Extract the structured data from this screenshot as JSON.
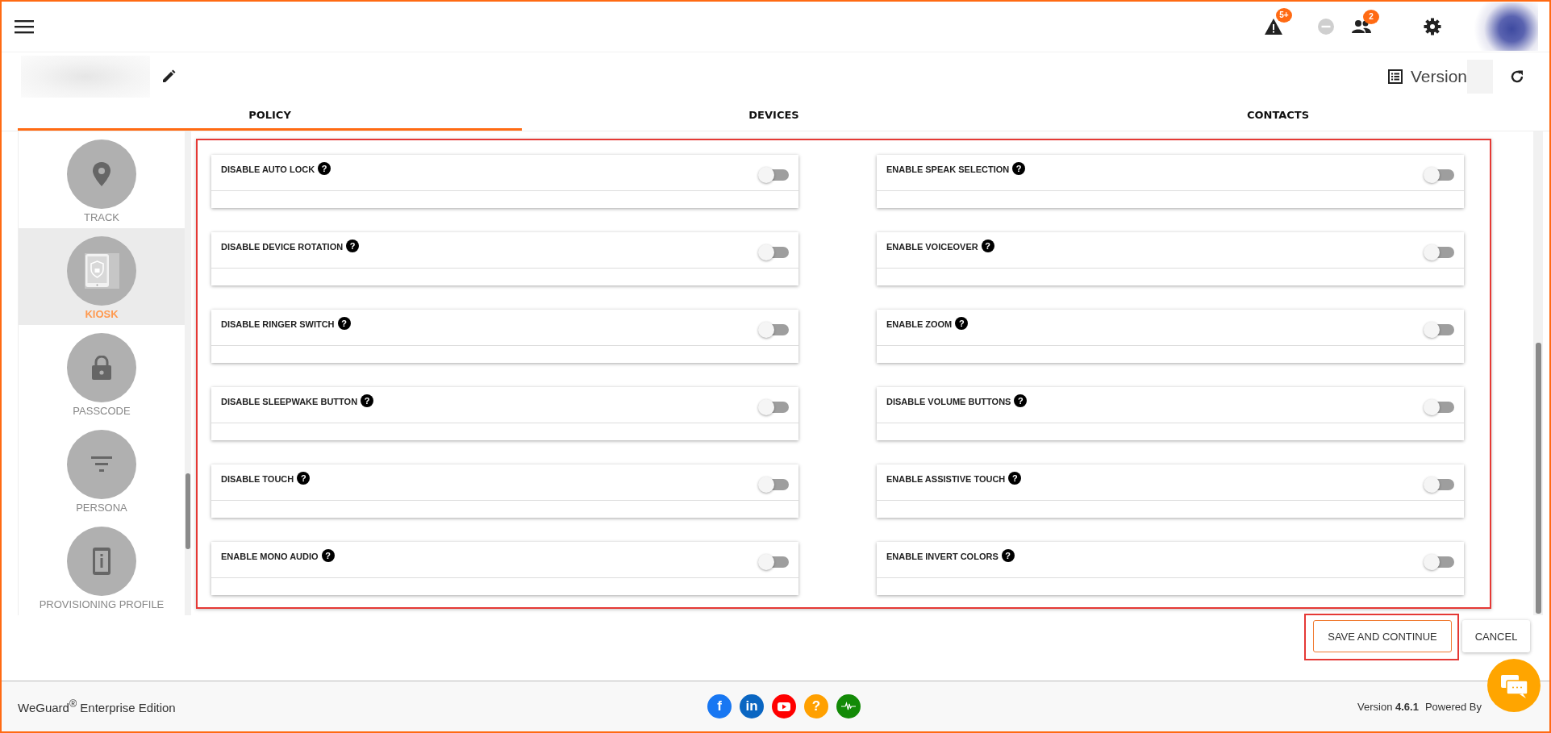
{
  "header": {
    "icons": [
      {
        "kind": "alert",
        "badge": "5+"
      },
      {
        "kind": "status"
      },
      {
        "kind": "people",
        "badge": "2"
      },
      {
        "kind": "settings"
      }
    ]
  },
  "policy": {
    "version_label": "Version"
  },
  "tabs": [
    {
      "label": "POLICY",
      "selected": true
    },
    {
      "label": "DEVICES",
      "selected": false
    },
    {
      "label": "CONTACTS",
      "selected": false
    }
  ],
  "sidebar": {
    "items": [
      {
        "label": "TRACK",
        "kind": "pin",
        "selected": false
      },
      {
        "label": "KIOSK",
        "kind": "kiosk",
        "selected": true
      },
      {
        "label": "PASSCODE",
        "kind": "lock",
        "selected": false
      },
      {
        "label": "PERSONA",
        "kind": "filter",
        "selected": false
      },
      {
        "label": "PROVISIONING PROFILE",
        "kind": "info",
        "selected": false
      }
    ]
  },
  "settings": [
    {
      "label": "DISABLE AUTO LOCK",
      "hint": "?",
      "on": false
    },
    {
      "label": "ENABLE SPEAK SELECTION",
      "hint": "?",
      "on": false
    },
    {
      "label": "DISABLE DEVICE ROTATION",
      "hint": "?",
      "on": false
    },
    {
      "label": "ENABLE VOICEOVER",
      "hint": "?",
      "on": false
    },
    {
      "label": "DISABLE RINGER SWITCH",
      "hint": "?",
      "on": false
    },
    {
      "label": "ENABLE ZOOM",
      "hint": "?",
      "on": false
    },
    {
      "label": "DISABLE SLEEPWAKE BUTTON",
      "hint": "?",
      "on": false
    },
    {
      "label": "DISABLE VOLUME BUTTONS",
      "hint": "?",
      "on": false
    },
    {
      "label": "DISABLE TOUCH",
      "hint": "?",
      "on": false
    },
    {
      "label": "ENABLE ASSISTIVE TOUCH",
      "hint": "?",
      "on": false
    },
    {
      "label": "ENABLE MONO AUDIO",
      "hint": "?",
      "on": false
    },
    {
      "label": "ENABLE INVERT COLORS",
      "hint": "?",
      "on": false
    }
  ],
  "actions": [
    {
      "label": "SAVE AND CONTINUE",
      "kind": "primary"
    },
    {
      "label": "CANCEL",
      "kind": "secondary"
    }
  ],
  "footer": {
    "edition": "WeGuard$^{®}$ Enterprise Edition",
    "social": [
      {
        "kind": "glyph",
        "glyph": "f",
        "color": "#1877f2"
      },
      {
        "kind": "glyph",
        "glyph": "in",
        "color": "#0a66c2"
      },
      {
        "kind": "play",
        "color": "#ff0000"
      },
      {
        "kind": "glyph",
        "glyph": "?",
        "color": "#ffa000"
      },
      {
        "kind": "pulse",
        "color": "#138a07"
      }
    ],
    "version": "Version **4.6.1**",
    "powered": "Powered By"
  }
}
